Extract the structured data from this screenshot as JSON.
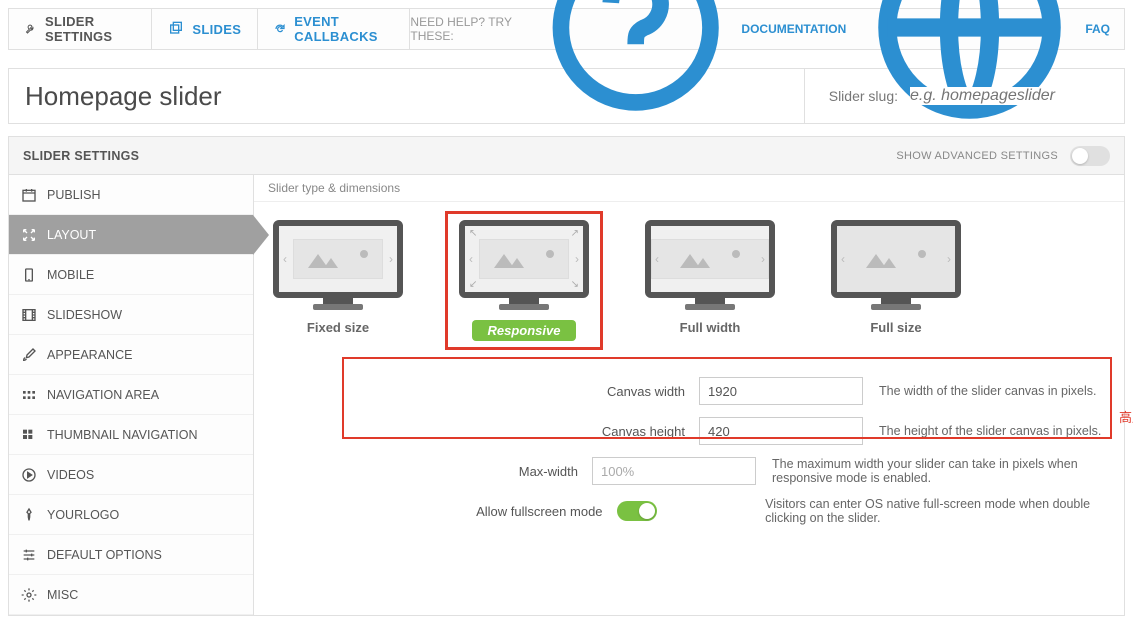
{
  "topTabs": {
    "sliderSettings": "SLIDER SETTINGS",
    "slides": "SLIDES",
    "eventCallbacks": "EVENT CALLBACKS"
  },
  "help": {
    "label": "NEED HELP? TRY THESE:",
    "documentation": "DOCUMENTATION",
    "faq": "FAQ"
  },
  "title": "Homepage slider",
  "slug": {
    "label": "Slider slug:",
    "placeholder": "e.g. homepageslider"
  },
  "panel": {
    "heading": "SLIDER SETTINGS",
    "advancedLabel": "SHOW ADVANCED SETTINGS"
  },
  "side": {
    "publish": "PUBLISH",
    "layout": "LAYOUT",
    "mobile": "MOBILE",
    "slideshow": "SLIDESHOW",
    "appearance": "APPEARANCE",
    "navigation": "NAVIGATION AREA",
    "thumbnav": "THUMBNAIL NAVIGATION",
    "videos": "VIDEOS",
    "yourlogo": "YOURLOGO",
    "defaultopts": "DEFAULT OPTIONS",
    "misc": "MISC"
  },
  "section": {
    "typeDimensions": "Slider type & dimensions"
  },
  "types": {
    "fixed": "Fixed size",
    "responsive": "Responsive",
    "fullwidth": "Full width",
    "fullsize": "Full size"
  },
  "form": {
    "canvasWidth": {
      "label": "Canvas width",
      "value": "1920",
      "desc": "The width of the slider canvas in pixels."
    },
    "canvasHeight": {
      "label": "Canvas height",
      "value": "420",
      "desc": "The height of the slider canvas in pixels."
    },
    "maxWidth": {
      "label": "Max-width",
      "value": "100%",
      "desc": "The maximum width your slider can take in pixels when responsive mode is enabled."
    },
    "fullscreen": {
      "label": "Allow fullscreen mode",
      "desc": "Visitors can enter OS native full-screen mode when double clicking on the slider."
    }
  },
  "annotation": "高度根据你banner图片高度来"
}
